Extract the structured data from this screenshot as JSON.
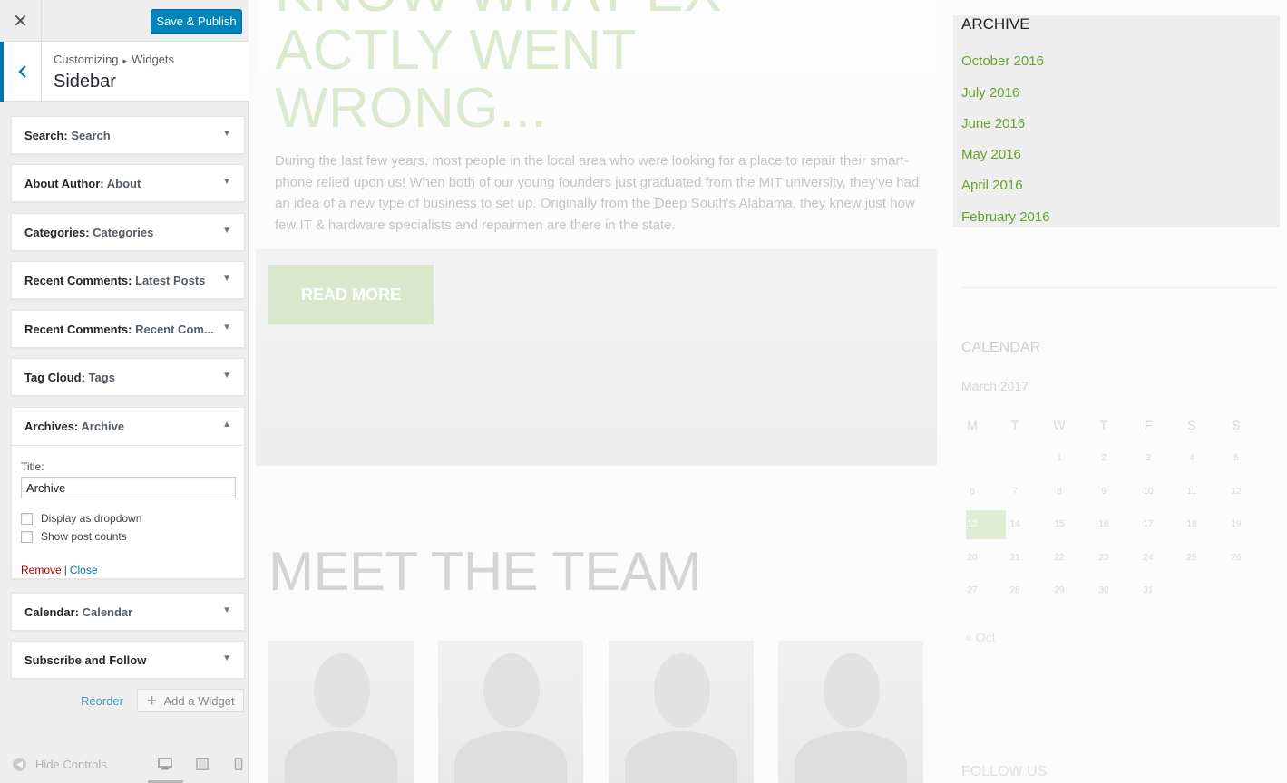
{
  "customizer": {
    "close_icon": "close-icon",
    "publish_label": "Save & Publish",
    "breadcrumb": {
      "root": "Customizing",
      "separator": "▸",
      "current": "Widgets"
    },
    "section_title": "Sidebar",
    "widgets": [
      {
        "type": "Search",
        "title": "Search"
      },
      {
        "type": "About Author",
        "title": "About"
      },
      {
        "type": "Categories",
        "title": "Categories"
      },
      {
        "type": "Recent Comments",
        "title": "Latest Posts"
      },
      {
        "type": "Recent Comments",
        "title": "Recent Com..."
      },
      {
        "type": "Tag Cloud",
        "title": "Tags"
      },
      {
        "type": "Archives",
        "title": "Archive"
      },
      {
        "type": "Calendar",
        "title": "Calendar"
      },
      {
        "type": "Subscribe and Follow",
        "title": ""
      }
    ],
    "archives_form": {
      "title_label": "Title:",
      "title_value": "Archive",
      "dropdown_label": "Display as dropdown",
      "post_counts_label": "Show post counts",
      "remove_label": "Remove",
      "separator": "|",
      "close_label": "Close"
    },
    "reorder_label": "Reorder",
    "add_widget_label": "Add a Widget",
    "hide_controls_label": "Hide Controls"
  },
  "preview": {
    "hero": {
      "title_lines": [
        "KNOW WHAT EX",
        "ACTLY WENT",
        "WRONG..."
      ],
      "text": "During the last few years, most people in the local area who were looking for a place to repair their smart-phone relied upon us! When both of our young founders just graduated from the MIT university, they've had an idea of a new type of business to set up. Originally from the Deep South's Alabama, they knew just how few IT & hardware specialists and repairmen are there in the state.",
      "button": "READ MORE"
    },
    "team_title": "MEET THE TEAM",
    "archive": {
      "title": "ARCHIVE",
      "links": [
        "October 2016",
        "July 2016",
        "June 2016",
        "May 2016",
        "April 2016",
        "February 2016"
      ]
    },
    "calendar": {
      "title": "CALENDAR",
      "month": "March 2017",
      "weekdays": [
        "M",
        "T",
        "W",
        "T",
        "F",
        "S",
        "S"
      ],
      "rows": [
        [
          "",
          "",
          "1",
          "2",
          "3",
          "4",
          "5"
        ],
        [
          "6",
          "7",
          "8",
          "9",
          "10",
          "11",
          "12"
        ],
        [
          "13",
          "14",
          "15",
          "16",
          "17",
          "18",
          "19"
        ],
        [
          "20",
          "21",
          "22",
          "23",
          "24",
          "25",
          "26"
        ],
        [
          "27",
          "28",
          "29",
          "30",
          "31",
          "",
          ""
        ]
      ],
      "today": "13",
      "prev": "« Oct"
    },
    "follow_title": "FOLLOW US"
  },
  "colors": {
    "accent": "#0085ba",
    "link_green": "#67a32d",
    "remove_red": "#aa0000"
  }
}
